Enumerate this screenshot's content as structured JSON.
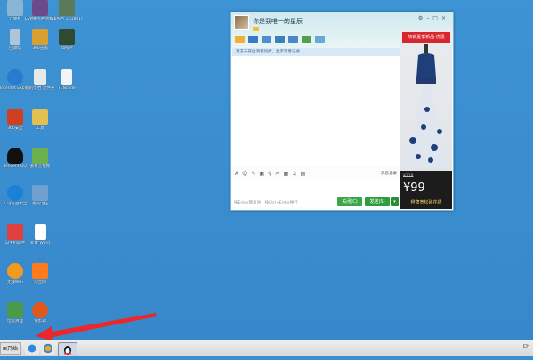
{
  "desktop_icons": [
    {
      "label": "计算机",
      "color": "#8ab6d6"
    },
    {
      "label": "EVM酷狗视频编辑器",
      "color": "#6a4a8a"
    },
    {
      "label": "vb照片 20180101",
      "color": "#5a7a5a"
    },
    {
      "label": "回收站",
      "color": "#b0c4d8"
    },
    {
      "label": "360压缩",
      "color": "#d9a030"
    },
    {
      "label": "vb照片",
      "color": "#304a30"
    },
    {
      "label": "Internet Explorer",
      "color": "#2a7ad0"
    },
    {
      "label": "我的文档 文件夹",
      "color": "#e8e8e8"
    },
    {
      "label": "TENcode",
      "color": "#f4f4f4"
    },
    {
      "label": "360安全",
      "color": "#d04020"
    },
    {
      "label": "工具",
      "color": "#e2c050"
    },
    {
      "label": "Tencent QQ",
      "color": "#111111"
    },
    {
      "label": "爱奇艺视频",
      "color": "#6ab04c"
    },
    {
      "label": "IE浏览器大全",
      "color": "#1a80d8"
    },
    {
      "label": "我的电脑",
      "color": "#6fa0d0"
    },
    {
      "label": "山手机助手",
      "color": "#e04040"
    },
    {
      "label": "新建 Word",
      "color": "#ffffff"
    },
    {
      "label": "无线WiFi",
      "color": "#f29a20"
    },
    {
      "label": "淘宝网",
      "color": "#ff7a1a"
    },
    {
      "label": "垃圾清理",
      "color": "#4a9a4a"
    },
    {
      "label": "快剪辑",
      "color": "#e05a20"
    }
  ],
  "chat": {
    "title": "你是我唯一的星辰",
    "notice": "对方未开启消息同步，显示消息记录",
    "history": "消息记录",
    "input_hint": "按Enter键发送，按Ctrl+Enter换行",
    "close_label": "关闭(C)",
    "send_label": "发送(S)",
    "ad": {
      "banner": "热销夏季新品·优惠",
      "original_price": "¥318",
      "price": "¥99",
      "name": "橙荫宽松碎花裙"
    }
  },
  "taskbar": {
    "start_label": "开始",
    "tray_text": "CH"
  }
}
